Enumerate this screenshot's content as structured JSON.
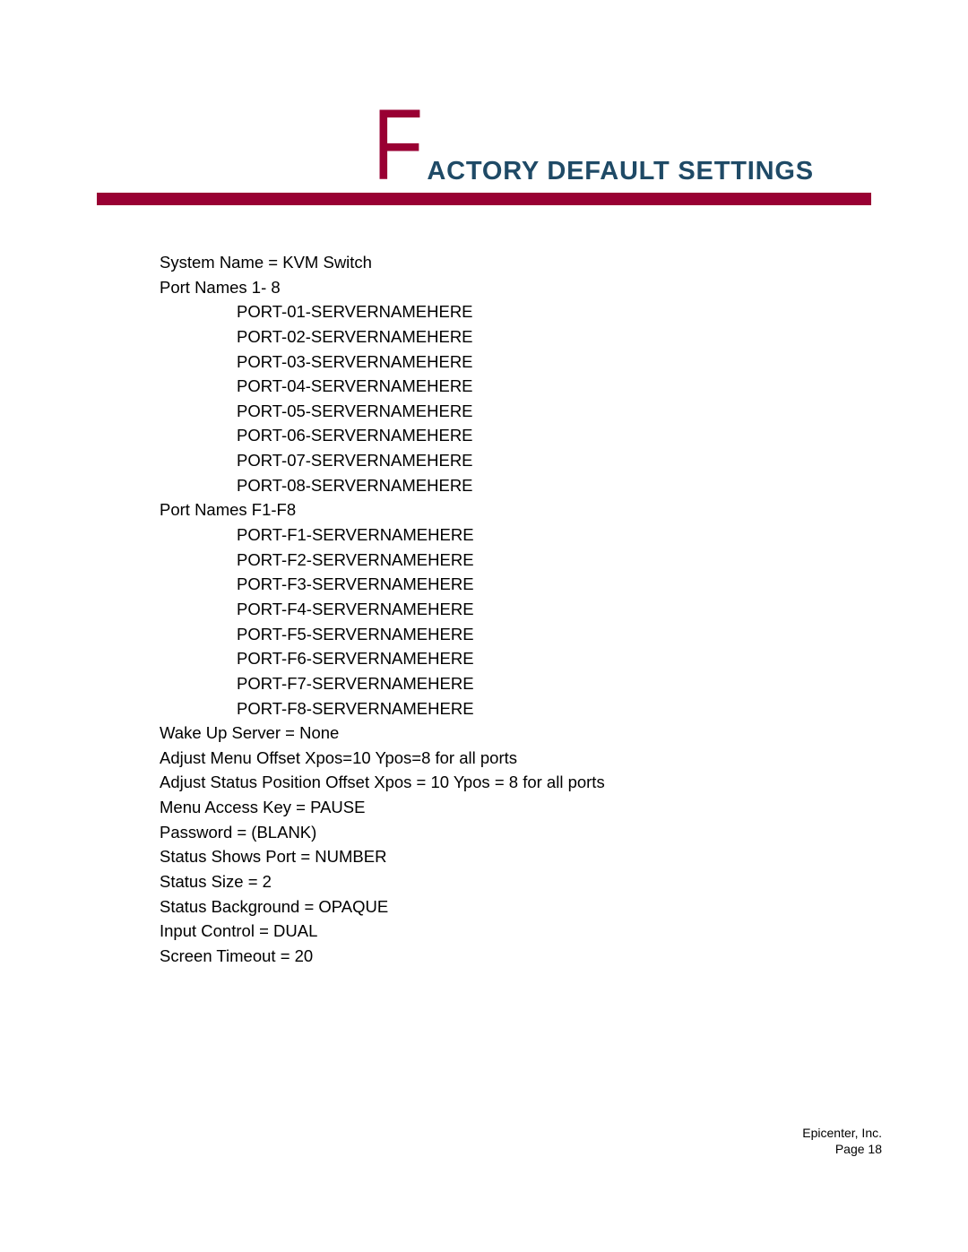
{
  "header": {
    "title_initial": "F",
    "title_rest": "ACTORY DEFAULT SETTINGS"
  },
  "colors": {
    "accent_red": "#990033",
    "title_blue": "#1f4a66"
  },
  "settings": {
    "system_name": "System Name = KVM Switch",
    "port_names_heading": "Port Names 1- 8",
    "port_names": [
      "PORT-01-SERVERNAMEHERE",
      "PORT-02-SERVERNAMEHERE",
      "PORT-03-SERVERNAMEHERE",
      "PORT-04-SERVERNAMEHERE",
      "PORT-05-SERVERNAMEHERE",
      "PORT-06-SERVERNAMEHERE",
      "PORT-07-SERVERNAMEHERE",
      "PORT-08-SERVERNAMEHERE"
    ],
    "port_names_f_heading": "Port Names F1-F8",
    "port_names_f": [
      "PORT-F1-SERVERNAMEHERE",
      "PORT-F2-SERVERNAMEHERE",
      "PORT-F3-SERVERNAMEHERE",
      "PORT-F4-SERVERNAMEHERE",
      "PORT-F5-SERVERNAMEHERE",
      "PORT-F6-SERVERNAMEHERE",
      "PORT-F7-SERVERNAMEHERE",
      "PORT-F8-SERVERNAMEHERE"
    ],
    "other": [
      "Wake Up Server = None",
      "Adjust Menu Offset Xpos=10 Ypos=8 for all ports",
      "Adjust Status Position Offset Xpos = 10 Ypos = 8 for all ports",
      "Menu Access Key = PAUSE",
      "Password = (BLANK)",
      "Status Shows Port = NUMBER",
      "Status Size = 2",
      "Status Background = OPAQUE",
      "Input Control = DUAL",
      "Screen Timeout = 20"
    ]
  },
  "footer": {
    "company": "Epicenter, Inc.",
    "page": "Page 18"
  }
}
